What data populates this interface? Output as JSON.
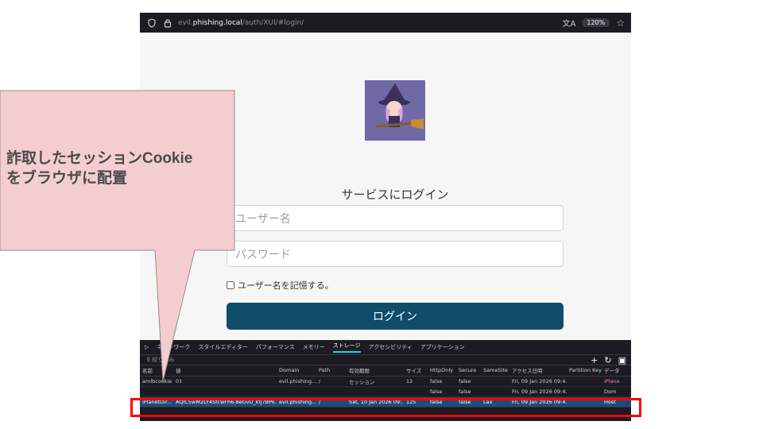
{
  "browser": {
    "url_prefix": "evil.",
    "url_host": "phishing.local",
    "url_path": "/auth/XUI/#login/",
    "zoom": "120%"
  },
  "login": {
    "title": "サービスにログイン",
    "username_placeholder": "ユーザー名",
    "password_placeholder": "パスワード",
    "remember_label": "ユーザー名を記憶する。",
    "login_button": "ログイン"
  },
  "devtools": {
    "tabs": [
      "ネットワーク",
      "スタイルエディター",
      "パフォーマンス",
      "メモリー",
      "ストレージ",
      "アクセシビリティ",
      "アプリケーション"
    ],
    "active_tab": "ストレージ",
    "filter_placeholder": "絞り込み",
    "columns": [
      "名前",
      "値",
      "Domain",
      "Path",
      "有効期限",
      "サイズ",
      "HttpOnly",
      "Secure",
      "SameSite",
      "アクセス日時",
      "Partition Key",
      "データ"
    ],
    "rows": [
      [
        "amlbcookie",
        "01",
        "evil.phishing....",
        "/",
        "セッション",
        "12",
        "false",
        "false",
        "",
        "Fri, 09 Jan 2026 09:4...",
        "",
        "iPlane"
      ],
      [
        "",
        "",
        "",
        "",
        "",
        "",
        "false",
        "false",
        "",
        "Fri, 09 Jan 2026 09:4...",
        "",
        "Dom"
      ],
      [
        "iPlanetDir...",
        "AQIC5wM2LY4SfcwFh6-8eGvU_kfj7BPk...",
        "evil.phishing....",
        "/",
        "Sat, 10 Jan 2026 09:...",
        "125",
        "false",
        "false",
        "Lax",
        "Fri, 09 Jan 2026 09:4...",
        "",
        "Host"
      ]
    ]
  },
  "annotation": {
    "callout_text": "詐取したセッションCookie\nをブラウザに配置",
    "callout_color": "#f4cdd0",
    "highlight_color": "#ff0000"
  }
}
